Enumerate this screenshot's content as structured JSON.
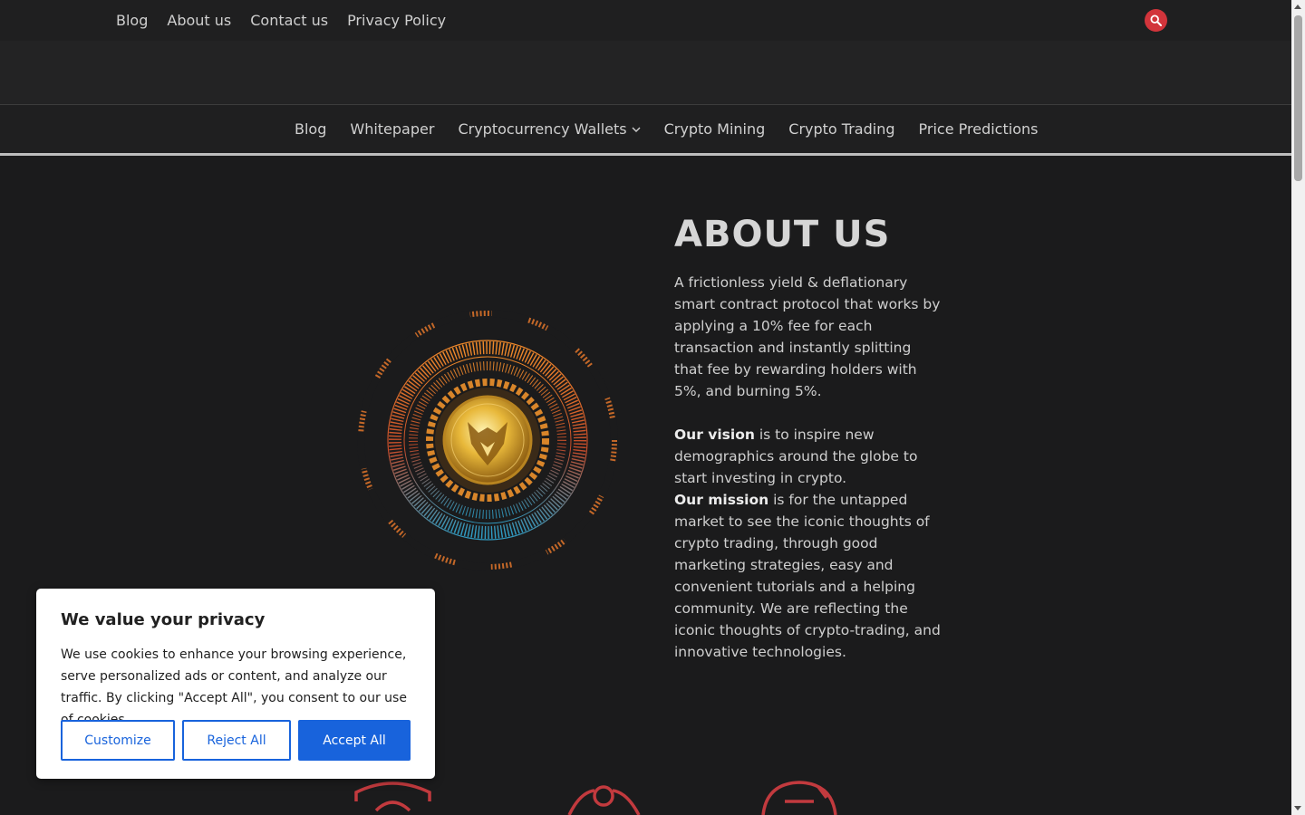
{
  "topnav": {
    "items": [
      "Blog",
      "About us",
      "Contact us",
      "Privacy Policy"
    ]
  },
  "mainnav": {
    "items": [
      "Blog",
      "Whitepaper",
      "Cryptocurrency Wallets",
      "Crypto Mining",
      "Crypto Trading",
      "Price Predictions"
    ]
  },
  "about": {
    "title": "ABOUT US",
    "intro": "A frictionless yield & deflationary smart contract protocol that works by applying a 10% fee for each transaction and instantly splitting that fee by rewarding holders with 5%, and burning 5%.",
    "vision_label": "Our vision",
    "vision_text": " is to inspire new demographics around the globe to start investing in crypto.",
    "mission_label": "Our mission",
    "mission_text": " is for the untapped market to see the iconic thoughts of crypto trading, through good marketing strategies, easy and convenient tutorials and a helping community. We are reflecting the iconic thoughts of crypto-trading, and innovative technologies."
  },
  "cookie": {
    "title": "We value your privacy",
    "text": "We use cookies to enhance your browsing experience, serve personalized ads or content, and analyze our traffic. By clicking \"Accept All\", you consent to our use of cookies.",
    "customize": "Customize",
    "reject": "Reject All",
    "accept": "Accept All"
  },
  "colors": {
    "accent_red": "#d2343b",
    "cookie_blue": "#1863dc",
    "background": "#1b1b1c"
  },
  "icons": {
    "search": "search-icon",
    "chevron": "chevron-down-icon"
  }
}
